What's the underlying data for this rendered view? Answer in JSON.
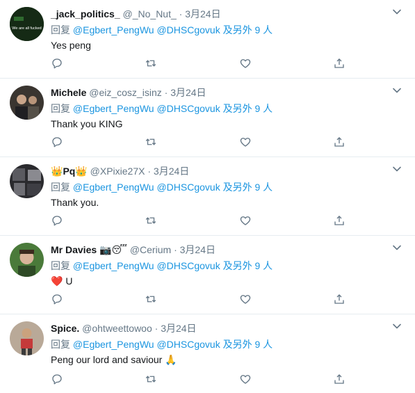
{
  "tweets": [
    {
      "name": "_jack_politics_",
      "name_emoji": "",
      "handle": "@_No_Nut_",
      "separator": "·",
      "date": "3月24日",
      "reply_prefix": "回复",
      "reply_mentions": "@Egbert_PengWu @DHSCgovuk 及另外 9 人",
      "text": "Yes peng",
      "avatar_text": "We are all fucked",
      "avatar_color": "#1a3a1a"
    },
    {
      "name": "Michele",
      "name_emoji": "",
      "handle": "@eiz_cosz_isinz",
      "separator": "·",
      "date": "3月24日",
      "reply_prefix": "回复",
      "reply_mentions": "@Egbert_PengWu @DHSCgovuk 及另外 9 人",
      "text": "Thank you KING",
      "avatar_color": "#3a3530"
    },
    {
      "name": "Pq",
      "name_emoji_before": "👑",
      "name_emoji_after": "👑",
      "handle": "@XPixie27X",
      "separator": "·",
      "date": "3月24日",
      "reply_prefix": "回复",
      "reply_mentions": "@Egbert_PengWu @DHSCgovuk 及另外 9 人",
      "text": "Thank you.",
      "avatar_color": "#2a2a2e"
    },
    {
      "name": "Mr Davies",
      "name_emoji": "📷😴",
      "handle": "@Cerium",
      "separator": "·",
      "date": "3月24日",
      "reply_prefix": "回复",
      "reply_mentions": "@Egbert_PengWu @DHSCgovuk 及另外 9 人",
      "text_emoji": "❤️",
      "text": "U",
      "avatar_color": "#4a7a3a"
    },
    {
      "name": "Spice.",
      "name_emoji": "",
      "handle": "@ohtweettowoo",
      "separator": "·",
      "date": "3月24日",
      "reply_prefix": "回复",
      "reply_mentions": "@Egbert_PengWu @DHSCgovuk 及另外 9 人",
      "text": "Peng our lord and saviour",
      "text_emoji_after": "🙏",
      "avatar_color": "#8a7a6a"
    }
  ],
  "icons": {
    "reply": "reply-icon",
    "retweet": "retweet-icon",
    "like": "like-icon",
    "share": "share-icon",
    "more": "chevron-down-icon"
  },
  "colors": {
    "link": "#1b95e0",
    "secondary_text": "#657786",
    "primary_text": "#14171a",
    "icon": "#657786",
    "divider": "#e6ecf0"
  }
}
